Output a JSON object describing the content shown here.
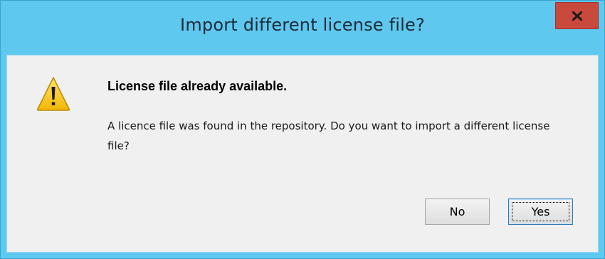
{
  "window": {
    "title": "Import different license file?",
    "close_icon": "close-icon",
    "title_bar_color": "#5fc8ef",
    "close_button_color": "#c9493d"
  },
  "dialog": {
    "icon": "warning-icon",
    "heading": "License file already available.",
    "message": "A licence file was found in the repository. Do you want to import a different license file?",
    "buttons": {
      "no_label": "No",
      "yes_label": "Yes"
    },
    "default_button": "Yes"
  }
}
